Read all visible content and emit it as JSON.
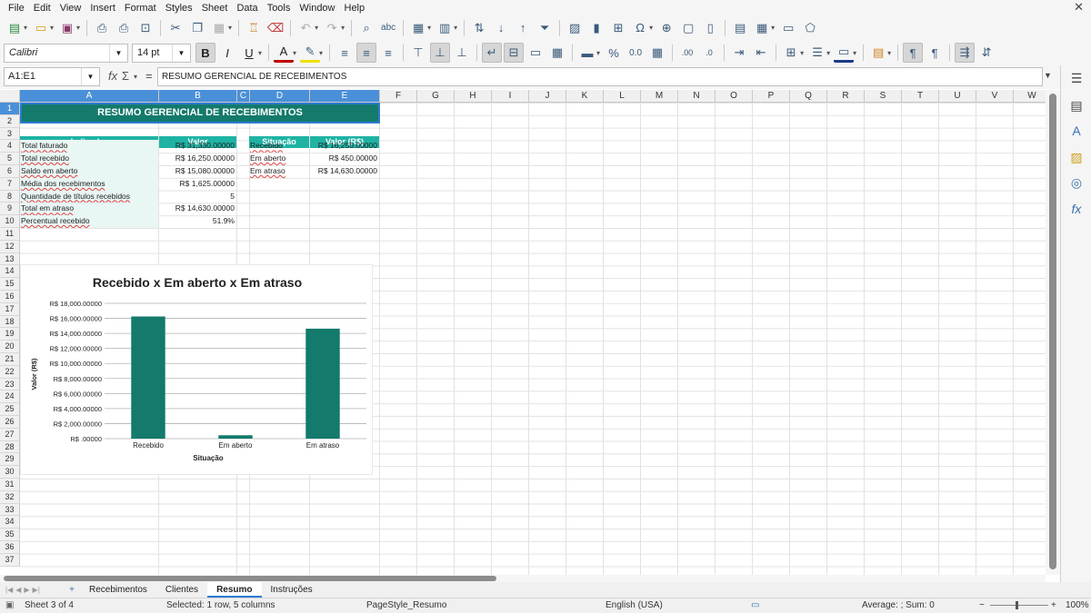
{
  "menu": [
    "File",
    "Edit",
    "View",
    "Insert",
    "Format",
    "Styles",
    "Sheet",
    "Data",
    "Tools",
    "Window",
    "Help"
  ],
  "toolbar": {
    "font_name": "Calibri",
    "font_size": "14 pt"
  },
  "formula_bar": {
    "name_box": "A1:E1",
    "content": "RESUMO GERENCIAL DE RECEBIMENTOS",
    "fx": "fx",
    "sigma": "Σ",
    "equals": "="
  },
  "columns": [
    "A",
    "B",
    "C",
    "D",
    "E",
    "F",
    "G",
    "H",
    "I",
    "J",
    "K",
    "L",
    "M",
    "N",
    "O",
    "P",
    "Q",
    "R",
    "S",
    "T",
    "U",
    "V",
    "W"
  ],
  "rows": [
    "1",
    "2",
    "3",
    "4",
    "5",
    "6",
    "7",
    "8",
    "9",
    "10",
    "11",
    "12",
    "13",
    "14",
    "15",
    "16",
    "17",
    "18",
    "19",
    "20",
    "21",
    "22",
    "23",
    "24",
    "25",
    "26",
    "27",
    "28",
    "29",
    "30",
    "31",
    "32",
    "33",
    "34",
    "35",
    "36",
    "37"
  ],
  "sheet": {
    "title": "RESUMO GERENCIAL DE RECEBIMENTOS",
    "table1": {
      "headers": [
        "Indicador",
        "Valor"
      ],
      "rows": [
        [
          "Total faturado",
          "R$ 31,330.00000"
        ],
        [
          "Total recebido",
          "R$ 16,250.00000"
        ],
        [
          "Saldo em aberto",
          "R$ 15,080.00000"
        ],
        [
          "Média dos recebimentos",
          "R$ 1,625.00000"
        ],
        [
          "Quantidade de títulos recebidos",
          "5"
        ],
        [
          "Total em atraso",
          "R$ 14,630.00000"
        ],
        [
          "Percentual recebido",
          "51.9%"
        ]
      ]
    },
    "table2": {
      "headers": [
        "Situação",
        "Valor (R$)"
      ],
      "rows": [
        [
          "Recebido",
          "R$ 16,250.00000"
        ],
        [
          "Em aberto",
          "R$ 450.00000"
        ],
        [
          "Em atraso",
          "R$ 14,630.00000"
        ]
      ]
    }
  },
  "chart_data": {
    "type": "bar",
    "title": "Recebido x Em aberto x Em atraso",
    "xlabel": "Situação",
    "ylabel": "Valor (R$)",
    "categories": [
      "Recebido",
      "Em aberto",
      "Em atraso"
    ],
    "values": [
      16250,
      450,
      14630
    ],
    "ylim": [
      0,
      18000
    ],
    "yticks": [
      0,
      2000,
      4000,
      6000,
      8000,
      10000,
      12000,
      14000,
      16000,
      18000
    ],
    "ytick_labels": [
      "R$ .00000",
      "R$ 2,000.00000",
      "R$ 4,000.00000",
      "R$ 6,000.00000",
      "R$ 8,000.00000",
      "R$ 10,000.00000",
      "R$ 12,000.00000",
      "R$ 14,000.00000",
      "R$ 16,000.00000",
      "R$ 18,000.00000"
    ],
    "bar_color": "#137a6c",
    "grid": true,
    "legend": "none"
  },
  "tabs": [
    "Recebimentos",
    "Clientes",
    "Resumo",
    "Instruções"
  ],
  "active_tab": "Resumo",
  "status": {
    "sheet": "Sheet 3 of 4",
    "selection": "Selected: 1 row, 5 columns",
    "page_style": "PageStyle_Resumo",
    "language": "English (USA)",
    "summary": "Average: ; Sum: 0",
    "zoom": "100%"
  },
  "colors": {
    "teal_dark": "#137a6c",
    "teal_header": "#1fb3a4",
    "selection": "#4a90d9"
  }
}
